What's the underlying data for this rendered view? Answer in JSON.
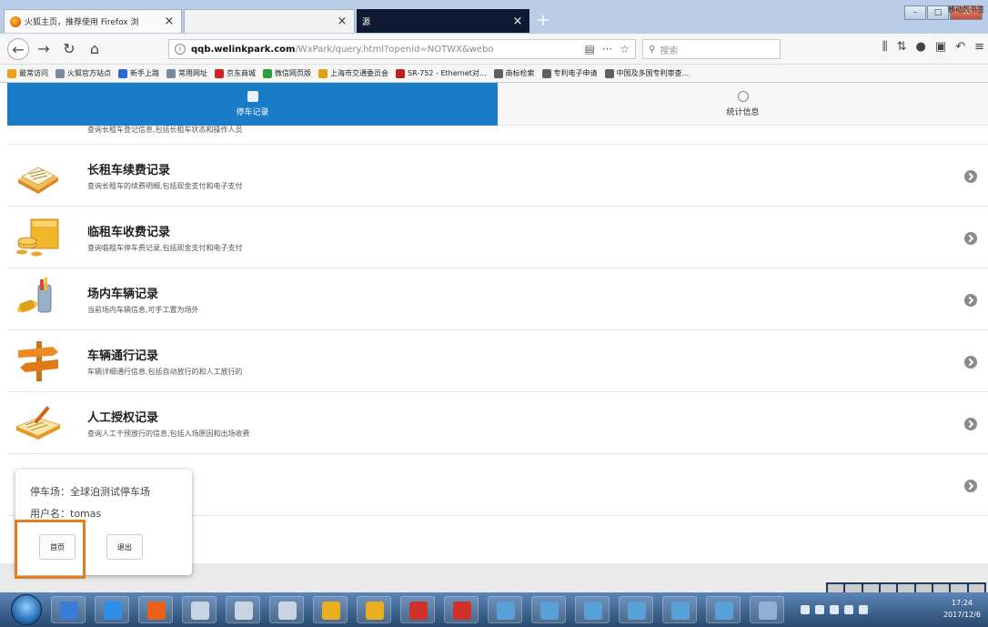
{
  "browser": {
    "tabs": [
      {
        "title": "火狐主页，推荐使用 Firefox 浏",
        "active": true
      },
      {
        "title": "",
        "active": false
      },
      {
        "title": "源",
        "active": false
      }
    ],
    "new_tab": "+",
    "url": {
      "domain": "qqb.welinkpark.com",
      "path": "/WxPark/query.html?openid=NOTWX&webo",
      "prefix": ""
    },
    "search_placeholder": "搜索",
    "bookmarks": [
      {
        "label": "最常访问",
        "color": "#f0a020"
      },
      {
        "label": "火狐官方站点",
        "color": "#7a8aa0"
      },
      {
        "label": "新手上路",
        "color": "#2a6ad0"
      },
      {
        "label": "常用网址",
        "color": "#7a8aa0"
      },
      {
        "label": "京东商城",
        "color": "#d02020"
      },
      {
        "label": "微信网页版",
        "color": "#2aa040"
      },
      {
        "label": "上海市交通委员会",
        "color": "#e0a010"
      },
      {
        "label": "SR-752 - Ethernet对...",
        "color": "#c02020"
      },
      {
        "label": "商标检索",
        "color": "#606060"
      },
      {
        "label": "专利电子申请",
        "color": "#606060"
      },
      {
        "label": "中国及多国专利审查...",
        "color": "#606060"
      }
    ],
    "bookmark_mobile": "移动版书签"
  },
  "app": {
    "tabs": [
      {
        "label": "停车记录",
        "active": true
      },
      {
        "label": "统计信息",
        "active": false
      }
    ],
    "partial_item": {
      "subtitle": "查询长租车登记信息,包括长租车状态和操作人员"
    },
    "items": [
      {
        "title": "长租车续费记录",
        "subtitle": "查询长租车的续费明细,包括现金支付和电子支付"
      },
      {
        "title": "临租车收费记录",
        "subtitle": "查询临租车停车费记录,包括现金支付和电子支付"
      },
      {
        "title": "场内车辆记录",
        "subtitle": "当前场内车辆信息,可手工置为场外"
      },
      {
        "title": "车辆通行记录",
        "subtitle": "车辆详细通行信息,包括自动放行的和人工放行的"
      },
      {
        "title": "人工授权记录",
        "subtitle": "查询人工干预放行的信息,包括入场原因和出场收费"
      },
      {
        "title": "",
        "subtitle": ""
      }
    ]
  },
  "popup": {
    "parking_lot": "停车场：全球泊测试停车场",
    "username": "用户名：tomas",
    "home_label": "首页",
    "logout_label": "退出"
  },
  "taskbar": {
    "clock_time": "17:24",
    "clock_date": "2017/12/6"
  },
  "colors": {
    "accent": "#1a7bc6",
    "highlight": "#e28020"
  }
}
